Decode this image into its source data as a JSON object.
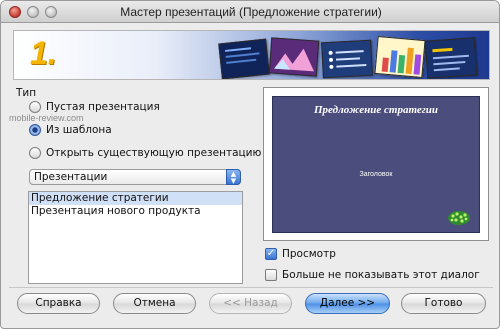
{
  "window": {
    "title": "Мастер презентаций (Предложение стратегии)"
  },
  "banner": {
    "step": "1."
  },
  "type_group": {
    "label": "Тип",
    "options": [
      {
        "label": "Пустая презентация",
        "selected": false
      },
      {
        "label": "Из шаблона",
        "selected": true
      },
      {
        "label": "Открыть существующую презентацию",
        "selected": false
      }
    ]
  },
  "watermark": "mobile-review.com",
  "category_select": {
    "value": "Презентации"
  },
  "template_list": {
    "items": [
      "Предложение стратегии",
      "Презентация нового продукта"
    ],
    "selected_index": 0
  },
  "preview": {
    "slide_title": "Предложение стратегии",
    "slide_heading": "Заголовок"
  },
  "options": {
    "preview_label": "Просмотр",
    "preview_checked": true,
    "dont_show_label": "Больше не показывать этот диалог",
    "dont_show_checked": false
  },
  "buttons": {
    "help": "Справка",
    "cancel": "Отмена",
    "back": "<< Назад",
    "next": "Далее >>",
    "done": "Готово"
  },
  "colors": {
    "step_number": "#f4b400",
    "slide_background": "#4b4e7c",
    "selection": "#d0e0f7",
    "default_button": "#4b8fe4"
  }
}
